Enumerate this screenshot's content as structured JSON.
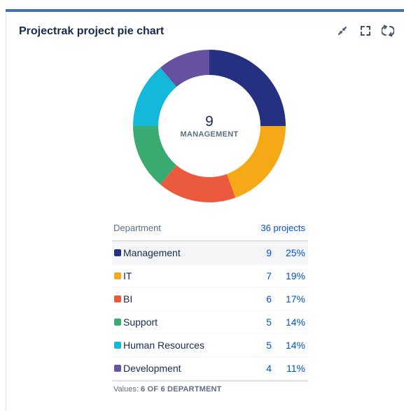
{
  "gadget": {
    "title": "Projectrak project pie chart",
    "accent_color": "#4a6fb5"
  },
  "controls": [
    {
      "name": "minimize-icon"
    },
    {
      "name": "fullscreen-icon"
    },
    {
      "name": "refresh-icon"
    }
  ],
  "center": {
    "value": "9",
    "label": "MANAGEMENT"
  },
  "table": {
    "header_label": "Department",
    "header_total": "36 projects",
    "rows": [
      {
        "name": "Management",
        "count": "9",
        "pct": "25%",
        "color": "#253080"
      },
      {
        "name": "IT",
        "count": "7",
        "pct": "19%",
        "color": "#f6a916"
      },
      {
        "name": "BI",
        "count": "6",
        "pct": "17%",
        "color": "#eb5a3c"
      },
      {
        "name": "Support",
        "count": "5",
        "pct": "14%",
        "color": "#3aab70"
      },
      {
        "name": "Human Resources",
        "count": "5",
        "pct": "14%",
        "color": "#14b8d8"
      },
      {
        "name": "Development",
        "count": "4",
        "pct": "11%",
        "color": "#6550a2"
      }
    ]
  },
  "footer": {
    "prefix": "Values:",
    "value": "6 OF 6 DEPARTMENT"
  },
  "chart_data": {
    "type": "pie",
    "categories": [
      "Management",
      "IT",
      "BI",
      "Support",
      "Human Resources",
      "Development"
    ],
    "values": [
      9,
      7,
      6,
      5,
      5,
      4
    ],
    "colors": [
      "#253080",
      "#f6a916",
      "#eb5a3c",
      "#3aab70",
      "#14b8d8",
      "#6550a2"
    ],
    "donut": true
  }
}
